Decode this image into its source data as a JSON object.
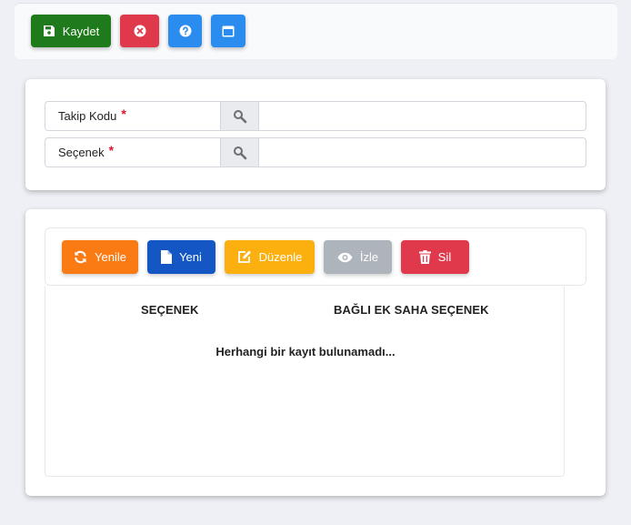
{
  "toolbar": {
    "save_label": "Kaydet",
    "save_icon": "save-icon",
    "cancel_icon": "close-circle-icon",
    "help_icon": "question-circle-icon",
    "window_icon": "window-icon",
    "colors": {
      "save": "#1e7a1a",
      "cancel": "#e0394b",
      "help": "#2b8cf0",
      "window": "#2b8cf0"
    }
  },
  "form": {
    "fields": [
      {
        "label": "Takip Kodu",
        "required_mark": "*",
        "value": "",
        "search_icon": "search-icon"
      },
      {
        "label": "Seçenek",
        "required_mark": "*",
        "value": "",
        "search_icon": "search-icon"
      }
    ]
  },
  "actions": {
    "refresh_label": "Yenile",
    "new_label": "Yeni",
    "edit_label": "Düzenle",
    "view_label": "İzle",
    "delete_label": "Sil",
    "colors": {
      "refresh": "#fa7a14",
      "new": "#1457c4",
      "edit": "#fbb00f",
      "view": "#aeb4bb",
      "delete": "#e0394b"
    }
  },
  "table": {
    "columns": [
      "SEÇENEK",
      "BAĞLI EK SAHA SEÇENEK"
    ],
    "rows": [],
    "empty_message": "Herhangi bir kayıt bulunamadı..."
  }
}
